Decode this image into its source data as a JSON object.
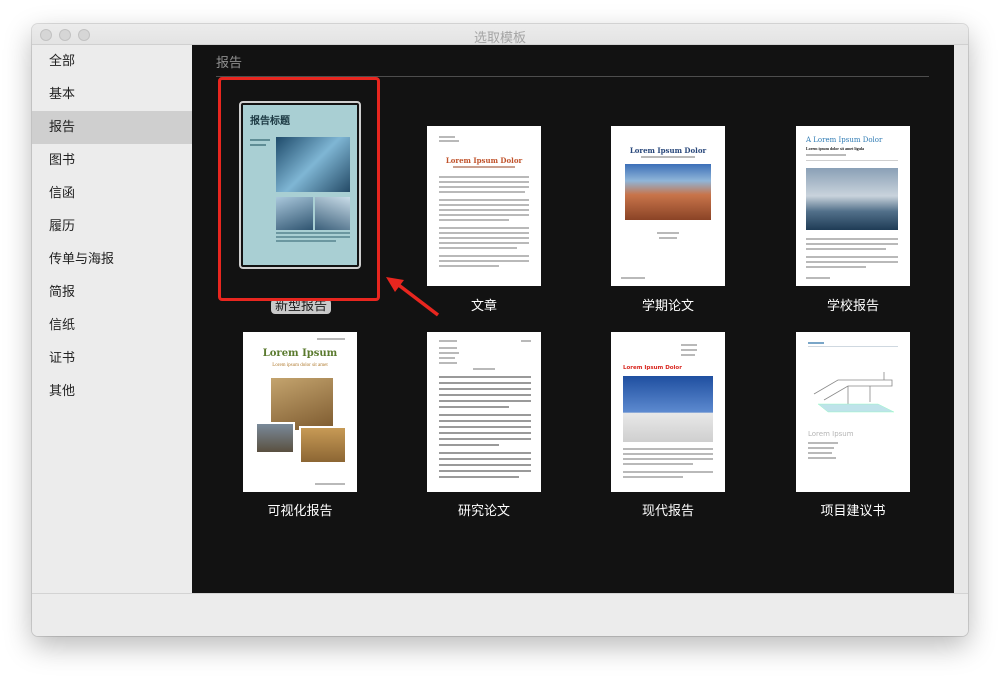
{
  "window": {
    "title": "选取模板"
  },
  "sidebar": {
    "selected_index": 2,
    "items": [
      {
        "label": "全部"
      },
      {
        "label": "基本"
      },
      {
        "label": "报告"
      },
      {
        "label": "图书"
      },
      {
        "label": "信函"
      },
      {
        "label": "履历"
      },
      {
        "label": "传单与海报"
      },
      {
        "label": "简报"
      },
      {
        "label": "信纸"
      },
      {
        "label": "证书"
      },
      {
        "label": "其他"
      }
    ]
  },
  "main": {
    "section_title": "报告",
    "templates": [
      {
        "label": "新型报告",
        "thumb_title": "报告标题"
      },
      {
        "label": "文章",
        "thumb_title": "Lorem Ipsum Dolor"
      },
      {
        "label": "学期论文",
        "thumb_title": "Lorem Ipsum Dolor"
      },
      {
        "label": "学校报告",
        "thumb_title": "A Lorem Ipsum Dolor",
        "thumb_subtitle": "Lorem ipsum dolor sit amet ligula"
      },
      {
        "label": "可视化报告",
        "thumb_title": "Lorem Ipsum",
        "thumb_subtitle": "Lorem ipsum dolor sit amet"
      },
      {
        "label": "研究论文"
      },
      {
        "label": "现代报告",
        "thumb_title": "Lorem Ipsum Dolor"
      },
      {
        "label": "项目建议书",
        "thumb_title": "Lorem Ipsum"
      }
    ]
  },
  "colors": {
    "highlight": "#e8261f",
    "main_bg": "#121212",
    "sidebar_selected": "#cfcfcf"
  }
}
